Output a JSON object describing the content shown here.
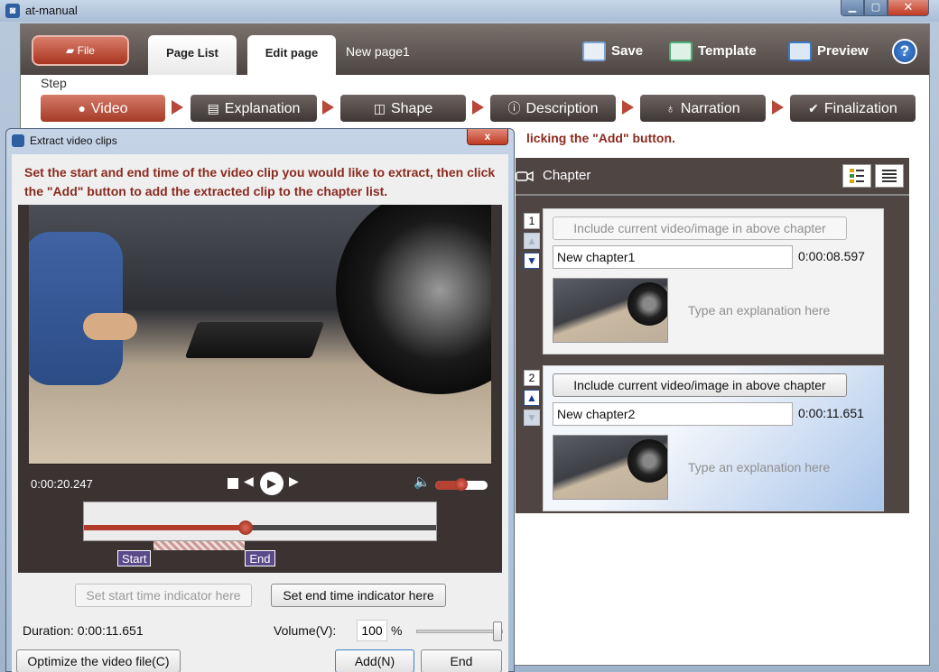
{
  "window": {
    "title": "at-manual"
  },
  "toolbar": {
    "file_label": "File",
    "tabs": [
      "Page List",
      "Edit page"
    ],
    "page_name": "New page1",
    "save_label": "Save",
    "template_label": "Template",
    "preview_label": "Preview",
    "help_label": "?"
  },
  "steps": {
    "label": "Step",
    "items": [
      "Video",
      "Explanation",
      "Shape",
      "Description",
      "Narration",
      "Finalization"
    ]
  },
  "instruction_visible": "licking the \"Add\" button.",
  "chapter_panel": {
    "title": "Chapter",
    "chapters": [
      {
        "number": "1",
        "include_label": "Include current video/image in above chapter",
        "name": "New chapter1",
        "time": "0:00:08.597",
        "explanation_placeholder": "Type an explanation here"
      },
      {
        "number": "2",
        "include_label": "Include current video/image in above chapter",
        "name": "New chapter2",
        "time": "0:00:11.651",
        "explanation_placeholder": "Type an explanation here"
      }
    ]
  },
  "dialog": {
    "title": "Extract video clips",
    "close_label": "x",
    "message": "Set the start and end time of the video clip you would like to extract, then click the \"Add\" button to add the extracted clip to the chapter list.",
    "player": {
      "time": "0:00:20.247",
      "volume_level": 0.5,
      "position_fraction": 0.46,
      "clip_start_fraction": 0.2,
      "clip_end_fraction": 0.46
    },
    "markers": {
      "start": "Start",
      "end": "End"
    },
    "set_start_label": "Set start time indicator here",
    "set_end_label": "Set end time indicator here",
    "duration": "Duration: 0:00:11.651",
    "volume_label": "Volume(V):",
    "volume_value": "100",
    "volume_unit": "%",
    "optimize_label": "Optimize the video file(C)",
    "add_label": "Add(N)",
    "end_label": "End"
  }
}
